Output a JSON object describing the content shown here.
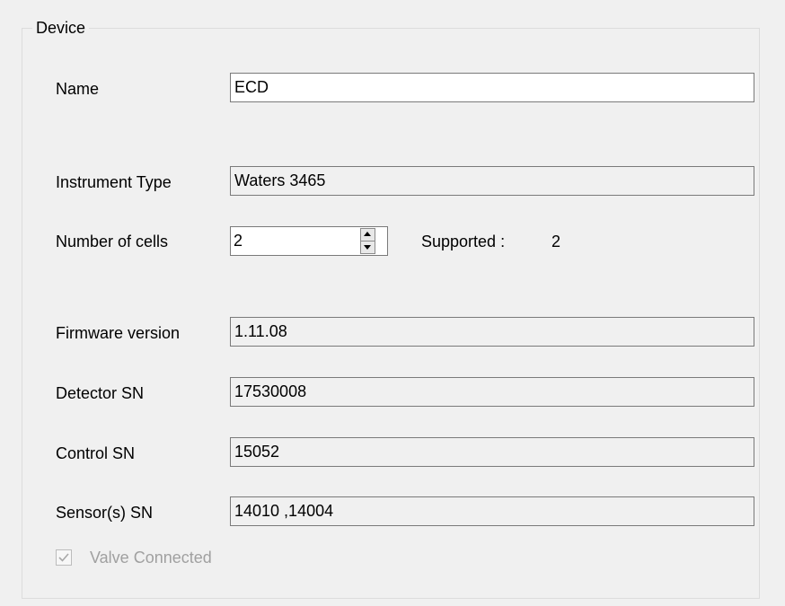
{
  "group": {
    "title": "Device"
  },
  "fields": {
    "name": {
      "label": "Name",
      "value": "ECD"
    },
    "instrument_type": {
      "label": "Instrument Type",
      "value": "Waters 3465"
    },
    "number_of_cells": {
      "label": "Number of cells",
      "value": "2"
    },
    "supported": {
      "label": "Supported :",
      "value": "2"
    },
    "firmware_version": {
      "label": "Firmware version",
      "value": "1.11.08"
    },
    "detector_sn": {
      "label": "Detector SN",
      "value": "17530008"
    },
    "control_sn": {
      "label": "Control SN",
      "value": "15052"
    },
    "sensors_sn": {
      "label": "Sensor(s) SN",
      "value": "14010 ,14004"
    }
  },
  "valve": {
    "label": "Valve Connected",
    "checked": true,
    "enabled": false
  },
  "icons": {
    "spin_up": "chevron-up-icon",
    "spin_down": "chevron-down-icon",
    "checkbox": "checkmark-icon"
  }
}
